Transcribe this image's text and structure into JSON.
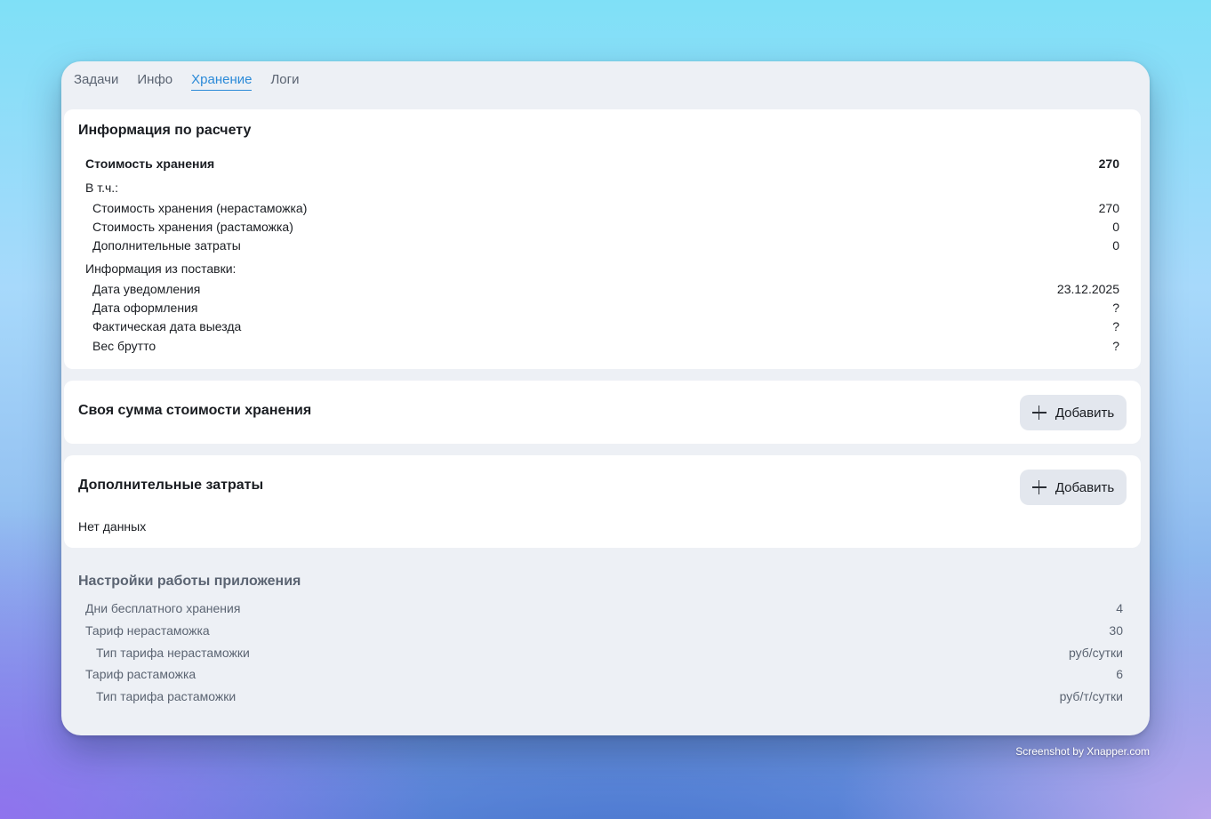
{
  "tabs": [
    {
      "label": "Задачи",
      "active": false
    },
    {
      "label": "Инфо",
      "active": false
    },
    {
      "label": "Хранение",
      "active": true
    },
    {
      "label": "Логи",
      "active": false
    }
  ],
  "calc": {
    "title": "Информация по расчету",
    "storage_cost_label": "Стоимость хранения",
    "storage_cost_value": "270",
    "including_label": "В т.ч.:",
    "non_customs_label": "Стоимость хранения (нерастаможка)",
    "non_customs_value": "270",
    "customs_label": "Стоимость хранения (растаможка)",
    "customs_value": "0",
    "extra_label": "Дополнительные затраты",
    "extra_value": "0",
    "delivery_info_label": "Информация из поставки:",
    "notify_date_label": "Дата уведомления",
    "notify_date_value": "23.12.2025",
    "processing_date_label": "Дата оформления",
    "processing_date_value": "?",
    "departure_date_label": "Фактическая дата выезда",
    "departure_date_value": "?",
    "gross_weight_label": "Вес брутто",
    "gross_weight_value": "?"
  },
  "custom_sum": {
    "title": "Своя сумма стоимости хранения",
    "add_label": "Добавить"
  },
  "extra_costs": {
    "title": "Дополнительные затраты",
    "add_label": "Добавить",
    "empty_text": "Нет данных"
  },
  "settings": {
    "title": "Настройки работы приложения",
    "free_days_label": "Дни бесплатного хранения",
    "free_days_value": "4",
    "tariff_non_customs_label": "Тариф нерастаможка",
    "tariff_non_customs_value": "30",
    "tariff_non_customs_type_label": "Тип тарифа нерастаможки",
    "tariff_non_customs_type_value": "руб/сутки",
    "tariff_customs_label": "Тариф растаможка",
    "tariff_customs_value": "6",
    "tariff_customs_type_label": "Тип тарифа растаможки",
    "tariff_customs_type_value": "руб/т/сутки"
  },
  "watermark": "Screenshot by Xnapper.com",
  "colors": {
    "accent": "#2b8ad8",
    "window_bg": "#edf0f5",
    "card_bg": "#ffffff",
    "button_bg": "#e3e7ee"
  }
}
